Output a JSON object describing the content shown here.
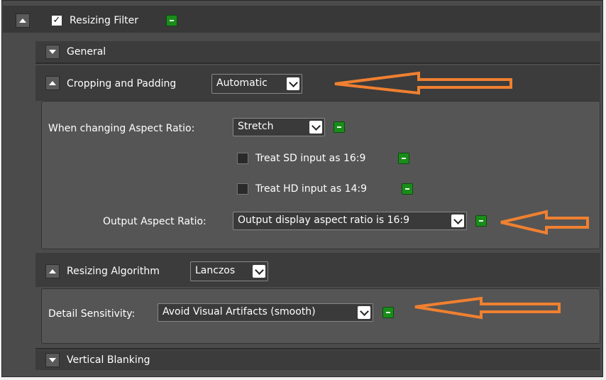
{
  "filter": {
    "title": "Resizing Filter",
    "enabled": true
  },
  "sections": {
    "general": {
      "label": "General"
    },
    "cropping": {
      "label": "Cropping and Padding",
      "mode": "Automatic"
    },
    "aspect": {
      "when_label": "When changing Aspect Ratio:",
      "when_value": "Stretch",
      "treat_sd": "Treat SD input as 16:9",
      "treat_hd": "Treat HD input as 14:9",
      "output_label": "Output Aspect Ratio:",
      "output_value": "Output display aspect ratio is 16:9"
    },
    "resizing": {
      "label": "Resizing Algorithm",
      "value": "Lanczos"
    },
    "detail": {
      "label": "Detail Sensitivity:",
      "value": "Avoid Visual Artifacts (smooth)"
    },
    "vertical": {
      "label": "Vertical Blanking"
    }
  },
  "colors": {
    "background": "#4b4b4b",
    "panel": "#555555",
    "reset_button": "#1a8c1a",
    "annotation_arrow": "#f08030"
  },
  "icons": {
    "collapse": "triangle-up-icon",
    "expand": "triangle-down-icon",
    "dropdown": "chevron-down-icon",
    "reset": "minus-icon",
    "annotation": "arrow-left-icon"
  }
}
